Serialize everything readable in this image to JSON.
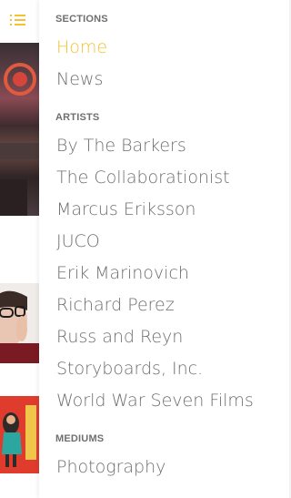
{
  "colors": {
    "accent": "#f2c230",
    "text": "#6e6e6e",
    "section_title": "#6f6f6f"
  },
  "menu_icon": "list-icon",
  "sections": [
    {
      "title": "SECTIONS",
      "items": [
        {
          "label": "Home",
          "active": true
        },
        {
          "label": "News"
        }
      ]
    },
    {
      "title": "ARTISTS",
      "items": [
        {
          "label": "By The Barkers"
        },
        {
          "label": "The Collaborationist"
        },
        {
          "label": "Marcus Eriksson"
        },
        {
          "label": "JUCO"
        },
        {
          "label": "Erik Marinovich"
        },
        {
          "label": "Richard Perez"
        },
        {
          "label": "Russ and Reyn"
        },
        {
          "label": "Storyboards, Inc."
        },
        {
          "label": "World War Seven Films"
        }
      ]
    },
    {
      "title": "MEDIUMS",
      "items": [
        {
          "label": "Photography"
        }
      ]
    }
  ]
}
